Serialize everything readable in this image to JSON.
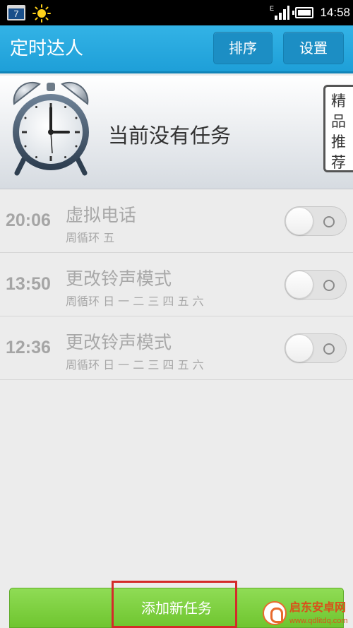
{
  "status_bar": {
    "calendar_day": "7",
    "weather_icon": "sun-icon",
    "network_label": "E",
    "time": "14:58"
  },
  "app_bar": {
    "title": "定时达人",
    "sort_label": "排序",
    "settings_label": "设置",
    "accent_color": "#29a9e1"
  },
  "banner": {
    "icon": "alarm-clock-icon",
    "message": "当前没有任务",
    "featured_tab": [
      "精",
      "品",
      "推",
      "荐"
    ]
  },
  "tasks": [
    {
      "time": "20:06",
      "title": "虚拟电话",
      "repeat": "周循环 五",
      "enabled": false
    },
    {
      "time": "13:50",
      "title": "更改铃声模式",
      "repeat": "周循环 日 一 二 三 四 五 六",
      "enabled": false
    },
    {
      "time": "12:36",
      "title": "更改铃声模式",
      "repeat": "周循环 日 一 二 三 四 五 六",
      "enabled": false
    }
  ],
  "footer": {
    "add_task_label": "添加新任务",
    "button_color": "#7ed043",
    "highlight_color": "#d42a2a"
  },
  "watermark": {
    "title": "启东安卓网",
    "url": "www.qdlitdq.com"
  }
}
